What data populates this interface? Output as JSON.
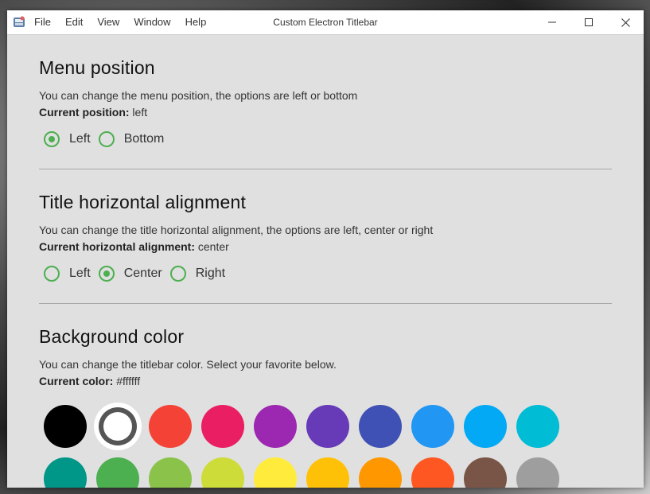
{
  "titlebar": {
    "title": "Custom Electron Titlebar",
    "menu": [
      "File",
      "Edit",
      "View",
      "Window",
      "Help"
    ],
    "background": "#ffffff"
  },
  "sections": {
    "menu_position": {
      "heading": "Menu position",
      "description": "You can change the menu position, the options are left or bottom",
      "current_label": "Current position:",
      "current_value": " left",
      "options": [
        "Left",
        "Bottom"
      ],
      "selected": "Left"
    },
    "title_alignment": {
      "heading": "Title horizontal alignment",
      "description": "You can change the title horizontal alignment, the options are left, center or right",
      "current_label": "Current horizontal alignment:",
      "current_value": " center",
      "options": [
        "Left",
        "Center",
        "Right"
      ],
      "selected": "Center"
    },
    "background_color": {
      "heading": "Background color",
      "description": "You can change the titlebar color. Select your favorite below.",
      "current_label": "Current color:",
      "current_value": " #ffffff",
      "selected": "#ffffff",
      "colors": [
        "#000000",
        "#ffffff",
        "#f44336",
        "#e91e63",
        "#9c27b0",
        "#673ab7",
        "#3f51b5",
        "#2196f3",
        "#03a9f4",
        "#00bcd4",
        "#009688",
        "#4caf50",
        "#8bc34a",
        "#cddc39",
        "#ffeb3b",
        "#ffc107",
        "#ff9800",
        "#ff5722",
        "#795548",
        "#9e9e9e"
      ]
    }
  },
  "accent_color": "#4caf50",
  "icons": {
    "app": "app-icon",
    "minimize": "minimize-icon",
    "maximize": "maximize-icon",
    "close": "close-icon"
  }
}
